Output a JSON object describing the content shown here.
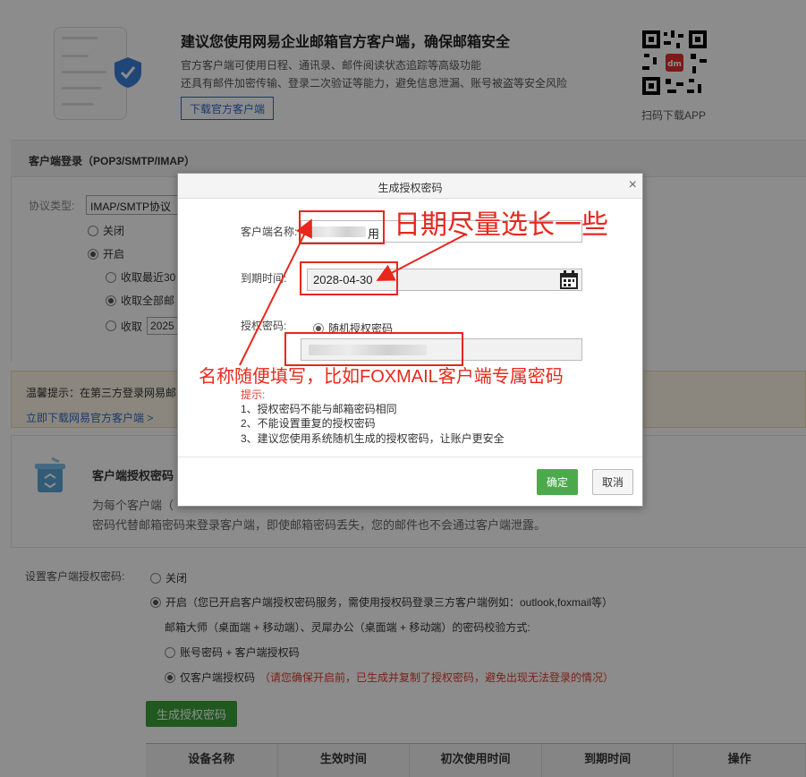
{
  "banner": {
    "title": "建议您使用网易企业邮箱官方客户端，确保邮箱安全",
    "desc_line1": "官方客户端可使用日程、通讯录、邮件阅读状态追踪等高级功能",
    "desc_line2": "还具有邮件加密传输、登录二次验证等能力，避免信息泄漏、账号被盗等安全风险",
    "download_button": "下载官方客户端",
    "qr_label": "扫码下载APP"
  },
  "client_login": {
    "heading": "客户端登录（POP3/SMTP/IMAP）",
    "protocol_label": "协议类型:",
    "protocol_value": "IMAP/SMTP协议",
    "options": [
      "关闭",
      "开启"
    ],
    "sub_options": [
      "收取最近30",
      "收取全部邮",
      "收取"
    ],
    "date_value": "2025"
  },
  "tip": {
    "text": "温馨提示：在第三方登录网易邮",
    "link": "立即下载网易官方客户端 >"
  },
  "auth_section": {
    "title": "客户端授权密码",
    "desc_line1": "为每个客户端（",
    "desc_line2": "密码代替邮箱密码来登录客户端，即使邮箱密码丢失，您的邮件也不会通过客户端泄露。"
  },
  "settings": {
    "label": "设置客户端授权密码:",
    "off": "关闭",
    "on": "开启（您已开启客户端授权密码服务，需使用授权码登录三方客户端例如：outlook,foxmail等）",
    "verify_label": "邮箱大师（桌面端 + 移动端）、灵犀办公（桌面端 + 移动端）的密码校验方式:",
    "verify_opt1": "账号密码 + 客户端授权码",
    "verify_opt2": "仅客户端授权码",
    "verify_warning": "（请您确保开启前，已生成并复制了授权密码，避免出现无法登录的情况）",
    "generate_button": "生成授权密码"
  },
  "table": {
    "columns": [
      "设备名称",
      "生效时间",
      "初次使用时间",
      "到期时间",
      "操作"
    ]
  },
  "modal": {
    "title": "生成授权密码",
    "close": "×",
    "name_label": "客户端名称:",
    "name_value": "用",
    "expire_label": "到期时间:",
    "expire_value": "2028-04-30",
    "password_label": "授权密码:",
    "password_option": "随机授权密码",
    "hint_title": "提示:",
    "hints": [
      "1、授权密码不能与邮箱密码相同",
      "2、不能设置重复的授权密码",
      "3、建议您使用系统随机生成的授权密码，让账户更安全"
    ],
    "ok_button": "确定",
    "cancel_button": "取消"
  },
  "annotations": {
    "date_note": "日期尽量选长一些",
    "name_note": "名称随便填写，比如FOXMAIL客户端专属密码",
    "color": "#e8271d"
  }
}
